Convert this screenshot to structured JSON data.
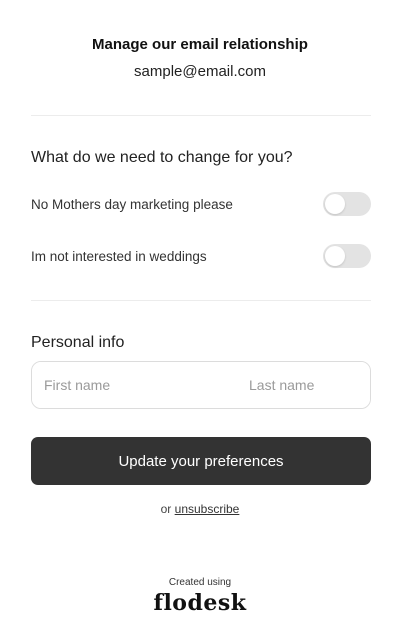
{
  "header": {
    "title": "Manage our email relationship",
    "email": "sample@email.com"
  },
  "preferences": {
    "heading": "What do we need to change for you?",
    "items": [
      {
        "label": "No Mothers day marketing please",
        "enabled": false
      },
      {
        "label": "Im not interested in weddings",
        "enabled": false
      }
    ]
  },
  "personal_info": {
    "heading": "Personal info",
    "first_name_placeholder": "First name",
    "last_name_placeholder": "Last name"
  },
  "actions": {
    "update_label": "Update your preferences",
    "or_text": "or",
    "unsubscribe_label": "unsubscribe"
  },
  "footer": {
    "created_using": "Created using",
    "brand": "flodesk"
  },
  "colors": {
    "button_bg": "#333333",
    "toggle_off": "#e3e3e3",
    "divider": "#ececec"
  }
}
